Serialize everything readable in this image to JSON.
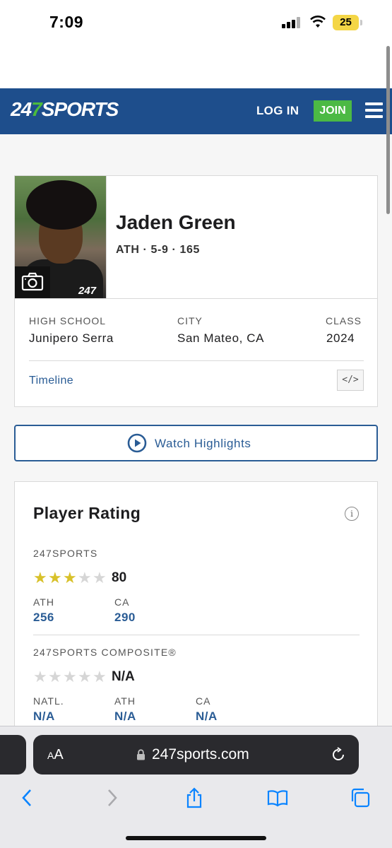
{
  "status_bar": {
    "time": "7:09",
    "battery": "25"
  },
  "header": {
    "logo_prefix": "24",
    "logo_seven": "7",
    "logo_suffix": "SPORTS",
    "login": "LOG IN",
    "join": "JOIN"
  },
  "player": {
    "name": "Jaden Green",
    "meta": "ATH · 5-9 · 165",
    "photo_watermark": "247",
    "high_school_label": "HIGH SCHOOL",
    "high_school": "Junipero Serra",
    "city_label": "CITY",
    "city": "San Mateo, CA",
    "class_label": "CLASS",
    "class": "2024",
    "timeline": "Timeline",
    "embed": "</>"
  },
  "highlights": {
    "label": "Watch Highlights"
  },
  "rating": {
    "title": "Player Rating",
    "info": "i",
    "sports247": {
      "label": "247SPORTS",
      "stars": 3,
      "score": "80",
      "ranks": [
        {
          "label": "ATH",
          "value": "256"
        },
        {
          "label": "CA",
          "value": "290"
        }
      ]
    },
    "composite": {
      "label": "247SPORTS COMPOSITE®",
      "stars": 0,
      "score": "N/A",
      "ranks": [
        {
          "label": "NATL.",
          "value": "N/A"
        },
        {
          "label": "ATH",
          "value": "N/A"
        },
        {
          "label": "CA",
          "value": "N/A"
        }
      ]
    }
  },
  "browser": {
    "aa": "AA",
    "url": "247sports.com"
  },
  "colors": {
    "brand_blue": "#1e4e8c",
    "join_green": "#4cb944",
    "link_blue": "#2a5c95",
    "star_gold": "#d8c12a"
  }
}
